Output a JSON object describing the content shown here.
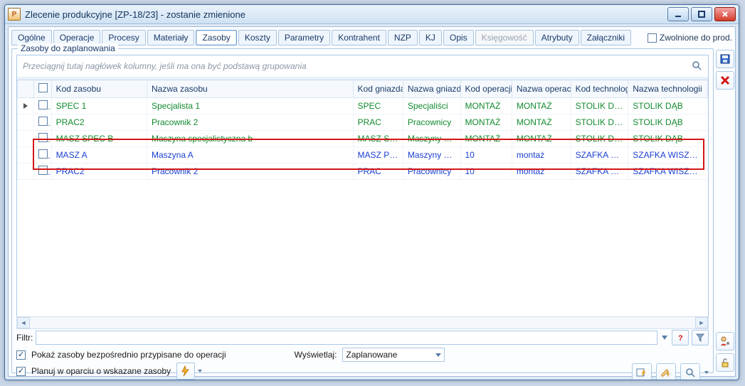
{
  "window": {
    "app_icon_letter": "P",
    "title": "Zlecenie produkcyjne  [ZP-18/23] - zostanie zmienione"
  },
  "tabs": [
    {
      "label": "Ogólne"
    },
    {
      "label": "Operacje"
    },
    {
      "label": "Procesy"
    },
    {
      "label": "Materiały"
    },
    {
      "label": "Zasoby",
      "active": true
    },
    {
      "label": "Koszty"
    },
    {
      "label": "Parametry"
    },
    {
      "label": "Kontrahent"
    },
    {
      "label": "NZP"
    },
    {
      "label": "KJ"
    },
    {
      "label": "Opis"
    },
    {
      "label": "Księgowość",
      "disabled": true
    },
    {
      "label": "Atrybuty"
    },
    {
      "label": "Załączniki"
    }
  ],
  "top_right": {
    "released_label": "Zwolnione do prod."
  },
  "group_title": "Zasoby do zaplanowania",
  "group_placeholder": "Przeciągnij tutaj nagłówek kolumny, jeśli ma ona być podstawą grupowania",
  "columns": {
    "kod_zasobu": "Kod zasobu",
    "nazwa_zasobu": "Nazwa zasobu",
    "kod_gniazda": "Kod gniazda",
    "nazwa_gniazda": "Nazwa gniazda",
    "kod_operacji": "Kod operacji",
    "nazwa_operacji": "Nazwa operacji",
    "kod_technologii": "Kod technologii",
    "nazwa_technologii": "Nazwa technologii"
  },
  "rows": [
    {
      "style": "green",
      "selected": true,
      "kod": "SPEC 1",
      "nazwa": "Specjalista 1",
      "kg": "SPEC",
      "ng": "Specjaliści",
      "ko": "MONTAŻ",
      "no": "MONTAŻ",
      "kt": "STOLIK DĄB",
      "nt": "STOLIK DĄB"
    },
    {
      "style": "green",
      "kod": "PRAC2",
      "nazwa": "Pracownik 2",
      "kg": "PRAC",
      "ng": "Pracownicy",
      "ko": "MONTAŻ",
      "no": "MONTAŻ",
      "kt": "STOLIK DĄB",
      "nt": "STOLIK DĄB"
    },
    {
      "style": "green",
      "kod": "MASZ SPEC B",
      "nazwa": "Maszyna specjalistyczna b",
      "kg": "MASZ SPEC",
      "ng": "Maszyny spe…",
      "ko": "MONTAŻ",
      "no": "MONTAŻ",
      "kt": "STOLIK DĄB",
      "nt": "STOLIK DĄB"
    },
    {
      "style": "blue",
      "kod": "MASZ A",
      "nazwa": "Maszyna A",
      "kg": "MASZ POD",
      "ng": "Maszyny pod…",
      "ko": "10",
      "no": "montaż",
      "kt": "SZAFKA WIS…",
      "nt": "SZAFKA WISZĄCA D"
    },
    {
      "style": "blue",
      "kod": "PRAC2",
      "nazwa": "Pracownik 2",
      "kg": "PRAC",
      "ng": "Pracownicy",
      "ko": "10",
      "no": "montaż",
      "kt": "SZAFKA WIS…",
      "nt": "SZAFKA WISZĄCA D"
    }
  ],
  "filter_label": "Filtr:",
  "display_label": "Wyświetlaj:",
  "display_value": "Zaplanowane",
  "opt_show_direct": "Pokaż zasoby bezpośrednio przypisane do operacji",
  "opt_plan_based": "Planuj w oparciu o wskazane zasoby"
}
